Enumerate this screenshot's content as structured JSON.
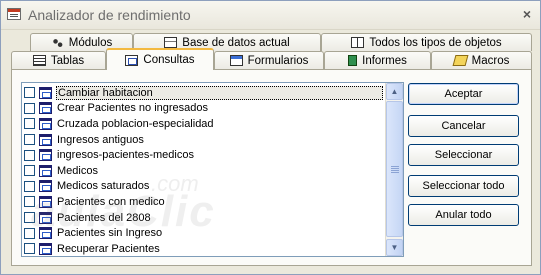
{
  "window": {
    "title": "Analizador de rendimiento",
    "close_label": "×"
  },
  "tabs_back": [
    {
      "label": "Módulos",
      "icon": "modules-icon"
    },
    {
      "label": "Base de datos actual",
      "icon": "database-icon"
    },
    {
      "label": "Todos los tipos de objetos",
      "icon": "all-objects-icon"
    }
  ],
  "tabs_front": [
    {
      "label": "Tablas",
      "icon": "table-icon"
    },
    {
      "label": "Consultas",
      "icon": "query-icon",
      "active": true
    },
    {
      "label": "Formularios",
      "icon": "form-icon"
    },
    {
      "label": "Informes",
      "icon": "report-icon"
    },
    {
      "label": "Macros",
      "icon": "macro-icon"
    }
  ],
  "queries": [
    {
      "label": "Cambiar habitacion",
      "checked": false,
      "selected": true
    },
    {
      "label": "Crear Pacientes no ingresados",
      "checked": false
    },
    {
      "label": "Cruzada poblacion-especialidad",
      "checked": false
    },
    {
      "label": "Ingresos antiguos",
      "checked": false
    },
    {
      "label": "ingresos-pacientes-medicos",
      "checked": false
    },
    {
      "label": "Medicos",
      "checked": false
    },
    {
      "label": "Medicos saturados",
      "checked": false
    },
    {
      "label": "Pacientes con medico",
      "checked": false
    },
    {
      "label": "Pacientes del 2808",
      "checked": false
    },
    {
      "label": "Pacientes sin Ingreso",
      "checked": false
    },
    {
      "label": "Recuperar Pacientes",
      "checked": false
    }
  ],
  "buttons": {
    "aceptar": "Aceptar",
    "cancelar": "Cancelar",
    "seleccionar": "Seleccionar",
    "seleccionar_todo": "Seleccionar todo",
    "anular_todo": "Anular todo"
  },
  "watermark": {
    "main": "aulaClic",
    "sub": ".com"
  },
  "colors": {
    "active_tab_accent": "#f3b940",
    "button_border": "#003c74",
    "list_border": "#7f9db9"
  }
}
